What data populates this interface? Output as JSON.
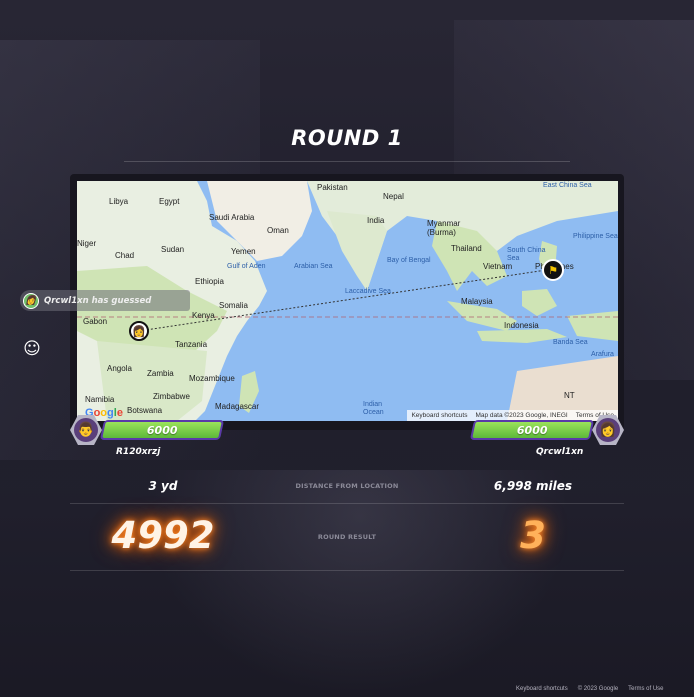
{
  "round": {
    "title": "ROUND 1"
  },
  "map": {
    "labels": [
      "Libya",
      "Egypt",
      "Saudi Arabia",
      "Oman",
      "Yemen",
      "Niger",
      "Chad",
      "Sudan",
      "Ethiopia",
      "Somalia",
      "Kenya",
      "Gabon",
      "Tanzania",
      "Angola",
      "Zambia",
      "Mozambique",
      "Zimbabwe",
      "Namibia",
      "Botswana",
      "Madagascar",
      "Pakistan",
      "Nepal",
      "India",
      "Myanmar\n(Burma)",
      "Thailand",
      "Vietnam",
      "Philippines",
      "Malaysia",
      "Indonesia",
      "NT"
    ],
    "seas": [
      "East China Sea",
      "Philippine Sea",
      "South China Sea",
      "Bay of Bengal",
      "Arabian Sea",
      "Laccadive Sea",
      "Gulf of Aden",
      "Banda Sea",
      "Arafura",
      "Indian Ocean"
    ],
    "keyboard_shortcuts": "Keyboard shortcuts",
    "map_data": "Map data ©2023 Google, INEGI",
    "terms": "Terms of Use",
    "google": "Google"
  },
  "toast": {
    "text": "Qrcwl1xn has guessed"
  },
  "players": {
    "left": {
      "name": "R120xrzj",
      "health": "6000",
      "distance": "3 yd",
      "score": "4992"
    },
    "right": {
      "name": "Qrcwl1xn",
      "health": "6000",
      "distance": "6,998 miles",
      "score": "3"
    }
  },
  "labels": {
    "distance": "DISTANCE FROM LOCATION",
    "round_result": "ROUND RESULT"
  },
  "footer": {
    "keyboard_shortcuts": "Keyboard shortcuts",
    "copyright": "© 2023 Google",
    "terms": "Terms of Use"
  },
  "icons": {
    "emoji": "smiley-icon",
    "flag": "flag-icon",
    "avatar": "avatar-icon"
  },
  "colors": {
    "health_fill": "#7fd14a",
    "health_border": "#5a3aa8",
    "score_glow": "#ff6a00"
  }
}
